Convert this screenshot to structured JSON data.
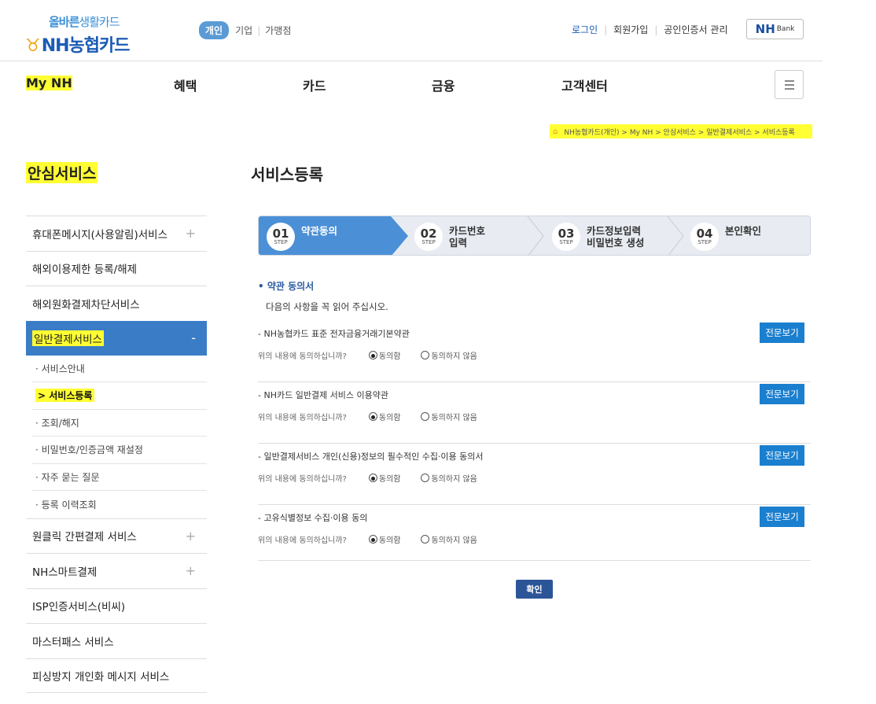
{
  "header": {
    "logo_tagline_bold": "올바른",
    "logo_tagline": "생활카드",
    "logo_brand": "NH농협카드",
    "segments": [
      "개인",
      "기업",
      "가맹점"
    ],
    "top_links": [
      "로그인",
      "회원가입",
      "공인인증서 관리"
    ],
    "nhbank_main": "NH",
    "nhbank_sub": "Bank"
  },
  "gnb": [
    "My NH",
    "혜택",
    "카드",
    "금융",
    "고객센터"
  ],
  "breadcrumb": "NH농협카드(개인) > My NH > 안심서비스 > 일반결제서비스 > 서비스등록",
  "side": {
    "title": "안심서비스",
    "items_top": [
      "휴대폰메시지(사용알림)서비스",
      "해외이용제한 등록/해제",
      "해외원화결제차단서비스"
    ],
    "active": "일반결제서비스",
    "subs": [
      "· 서비스안내",
      "> 서비스등록",
      "· 조회/해지",
      "· 비밀번호/인증금액 재설정",
      "· 자주 묻는 질문",
      "· 등록 이력조회"
    ],
    "items_bottom": [
      "원클릭 간편결제 서비스",
      "NH스마트결제",
      "ISP인증서비스(비씨)",
      "마스터패스 서비스",
      "피싱방지 개인화 메시지 서비스"
    ]
  },
  "page_title": "서비스등록",
  "steps": [
    {
      "num": "01",
      "step": "STEP",
      "label1": "약관동의",
      "label2": ""
    },
    {
      "num": "02",
      "step": "STEP",
      "label1": "카드번호",
      "label2": "입력"
    },
    {
      "num": "03",
      "step": "STEP",
      "label1": "카드정보입력",
      "label2": "비밀번호 생성"
    },
    {
      "num": "04",
      "step": "STEP",
      "label1": "본인확인",
      "label2": ""
    }
  ],
  "section_title": "• 약관 동의서",
  "notice": "다음의 사항을 꼭 읽어 주십시오.",
  "terms": [
    {
      "title": "NH농협카드 표준 전자금융거래기본약관",
      "button": "전문보기"
    },
    {
      "title": "NH카드 일반결제 서비스 이용약관",
      "button": "전문보기"
    },
    {
      "title": "일반결제서비스 개인(신용)정보의 필수적인 수집·이용 동의서",
      "button": "전문보기"
    },
    {
      "title": "고유식별정보 수집·이용 동의",
      "button": "전문보기"
    }
  ],
  "question": "위의 내용에 동의하십니까?",
  "agree": "동의함",
  "disagree": "동의하지 않음",
  "confirm": "확인",
  "colors": {
    "accent": "#4b8fd6",
    "brand": "#1a5bb5",
    "highlight": "#ffff33",
    "button": "#1b7fcf"
  }
}
